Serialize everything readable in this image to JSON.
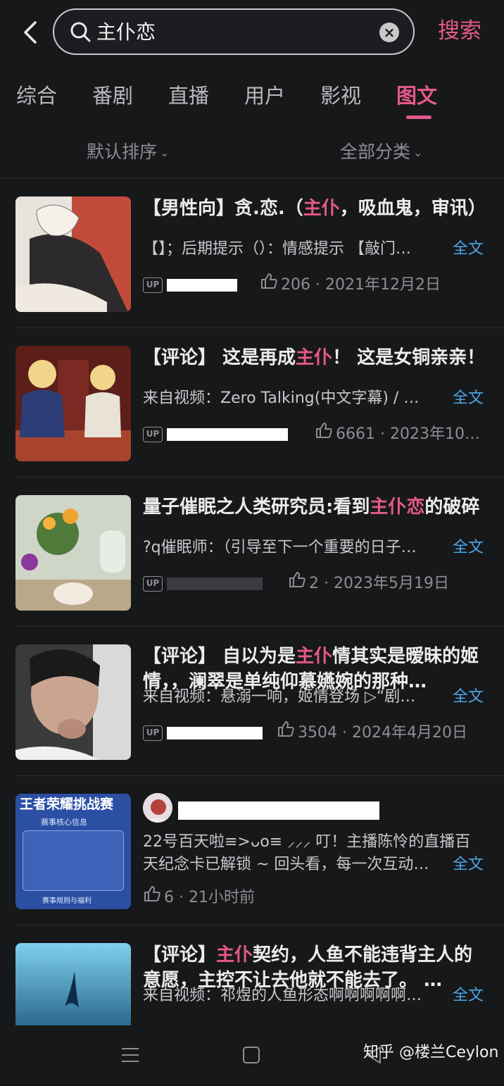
{
  "search": {
    "query": "主仆恋",
    "button_label": "搜索"
  },
  "tabs": [
    {
      "label": "综合",
      "active": false
    },
    {
      "label": "番剧",
      "active": false
    },
    {
      "label": "直播",
      "active": false
    },
    {
      "label": "用户",
      "active": false
    },
    {
      "label": "影视",
      "active": false
    },
    {
      "label": "图文",
      "active": true
    }
  ],
  "filters": {
    "sort_label": "默认排序",
    "category_label": "全部分类"
  },
  "full_text_label": "全文",
  "accent_color": "#e4588a",
  "link_color": "#4aa7e8",
  "results": [
    {
      "title_parts": [
        "【男性向】贪.恋.（",
        "主仆",
        "，吸血鬼，审讯）"
      ],
      "desc": "【】；后期提示（）：情感提示 【敲门…",
      "likes": "206",
      "date": "2021年12月2日"
    },
    {
      "title_parts": [
        "【评论】 这是再成",
        "主仆",
        "！ 这是女铜亲亲！"
      ],
      "desc": "来自视频：Zero Talking(中文字幕) / …",
      "likes": "6661",
      "date": "2023年10…"
    },
    {
      "title_parts": [
        "量子催眠之人类研究员:看到",
        "主仆恋",
        "的破碎"
      ],
      "desc": "?q催眠师：（引导至下一个重要的日子…",
      "likes": "2",
      "date": "2023年5月19日"
    },
    {
      "title_parts": [
        "【评论】 自以为是",
        "主仆",
        "情其实是暧昧的姬情，，澜翠是单纯仰慕嬿婉的那种…"
      ],
      "desc": "来自视频：悬溺一响，姬情登场 ▷“剧…",
      "likes": "3504",
      "date": "2024年4月20日"
    },
    {
      "thumb_title": "王者荣耀挑战赛",
      "thumb_subtitle": "赛事核心信息",
      "thumb_footer": "赛事规则与福利",
      "desc_line1": "22号百天啦≡>ᴗo≡ ⸝⸝⸝ 叮！主播陈怜的直播百",
      "desc_line2": "天纪念卡已解锁 ~ 回头看，每一次互动…",
      "likes": "6",
      "time": "21小时前"
    },
    {
      "title_parts": [
        "【评论】",
        "主仆",
        "契约，人鱼不能违背主人的意愿，主控不让去他就不能去了。 …"
      ],
      "desc": "来自视频：祁煜的人鱼形态啊啊啊啊啊…"
    }
  ],
  "watermark": "知乎 @楼兰Ceylon",
  "icons": [
    "back-arrow-icon",
    "search-icon",
    "clear-icon",
    "chevron-down-icon",
    "up-badge-icon",
    "thumbs-up-icon",
    "menu-icon",
    "home-icon",
    "back-icon"
  ]
}
